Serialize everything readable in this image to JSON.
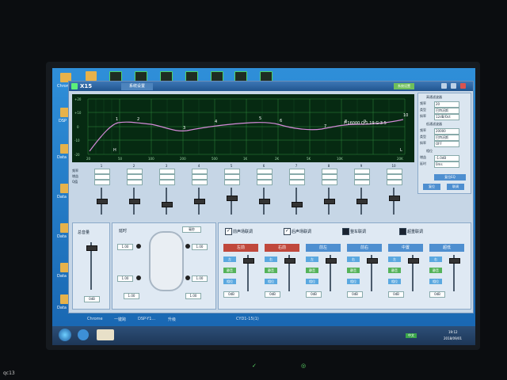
{
  "desktop": {
    "left_icons": [
      "Chrome",
      "DSP",
      "Data",
      "Data",
      "Data",
      "Data",
      "Data"
    ],
    "taskbar_labels": [
      "Chrome",
      "一键跨",
      "DSP-Y1...",
      "升级",
      "CYD1-15(1)"
    ]
  },
  "app": {
    "title": "X15",
    "tab_label": "系统设置",
    "top_button": "系统设置"
  },
  "eq_graph": {
    "x_ticks": [
      "20",
      "50",
      "100",
      "200",
      "500",
      "1K",
      "2K",
      "5K",
      "10K",
      "20K"
    ],
    "y_ticks": [
      "+20",
      "+10",
      "0",
      "-10",
      "-20"
    ],
    "point_labels": [
      "1",
      "2",
      "3",
      "4",
      "5",
      "6",
      "7",
      "8",
      "9",
      "10"
    ],
    "marker_H": "H",
    "marker_L": "L",
    "readout": "F:16000 Q:1.19 G:3.5"
  },
  "filter_panel": {
    "title_hp": "高通滤波器",
    "title_lp": "低通滤波器",
    "freq_label": "频率",
    "type_label": "类型",
    "slope_label": "斜率",
    "hp_freq": "20",
    "hp_type": "巴特沃斯",
    "hp_slope": "12dB/Oct",
    "lp_freq": "20000",
    "lp_type": "巴特沃斯",
    "lp_slope": "OFF",
    "phase_label": "相位",
    "gain_label": "增益",
    "delay_label": "延时",
    "gain_value": "-1.0dB",
    "delay_value": "0ms",
    "reset_button": "复位",
    "link_button": "联调",
    "eq_reset": "复位EQ",
    "eq_bypass": "直通"
  },
  "channels": {
    "row_labels": [
      "频率",
      "增益",
      "Q值"
    ],
    "numbers": [
      "1",
      "2",
      "3",
      "4",
      "5",
      "6",
      "7",
      "8",
      "9",
      "10"
    ]
  },
  "master": {
    "label": "总音量",
    "value": "0dB"
  },
  "delay": {
    "label": "延时",
    "unit": "毫秒",
    "values": [
      "1.00",
      "1.00",
      "1.00",
      "1.00",
      "1.00",
      "1.00"
    ]
  },
  "speaker_links": {
    "front_label": "前声场联调",
    "rear_label": "后声场联调",
    "full_label": "整车联调",
    "bass_label": "超重联调",
    "groups": [
      "左前",
      "右前",
      "前左",
      "前右",
      "中置",
      "超低"
    ],
    "btn_left": "左",
    "btn_right": "右",
    "btn_mute": "静音",
    "btn_phase": "相位",
    "db_value": "0dB"
  },
  "taskbar": {
    "time": "19:12",
    "date": "2018/09/01",
    "badge": "中文"
  },
  "bezel": {
    "left_symbol": "✓",
    "right_symbol": "◎"
  },
  "corner_text": "qc13"
}
